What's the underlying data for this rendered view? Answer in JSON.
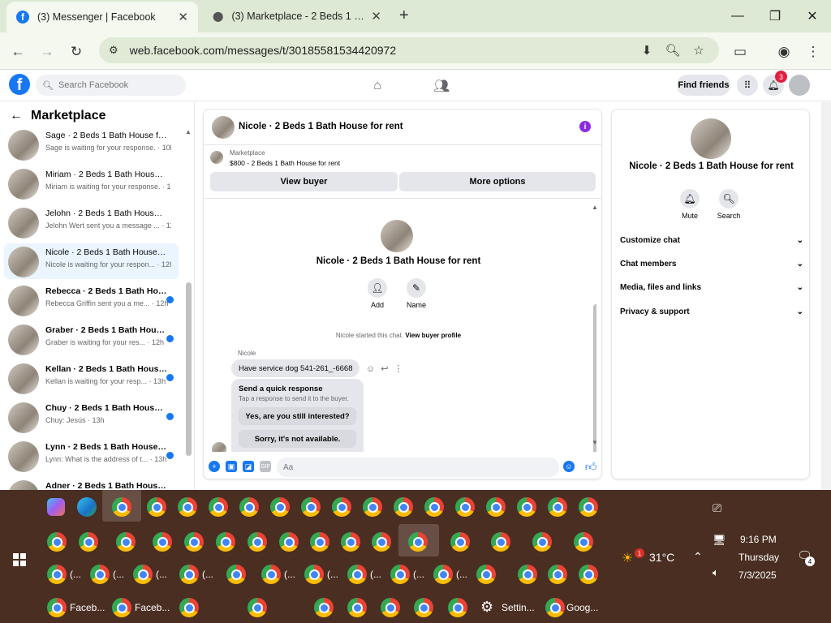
{
  "browser": {
    "tabs": [
      {
        "title": "(3) Messenger | Facebook"
      },
      {
        "title": "(3) Marketplace - 2 Beds 1 Bath"
      }
    ],
    "url": "web.facebook.com/messages/t/30185581534420972",
    "new_tab_glyph": "+",
    "close_glyph": "✕"
  },
  "facebook_header": {
    "logo_letter": "f",
    "search_placeholder": "Search Facebook",
    "find_friends": "Find friends",
    "notification_count": "3"
  },
  "marketplace": {
    "title": "Marketplace",
    "conversations": [
      {
        "name": "Sage · 2 Beds 1 Bath House for ...",
        "preview": "Sage is waiting for your response. · 10h",
        "unread": false,
        "selected": false
      },
      {
        "name": "Miriam · 2 Beds 1 Bath House f...",
        "preview": "Miriam is waiting for your response. · 10h",
        "unread": false,
        "selected": false
      },
      {
        "name": "Jelohn · 2 Beds 1 Bath House fo...",
        "preview": "Jelohn Wert sent you a message ... · 11h",
        "unread": false,
        "selected": false
      },
      {
        "name": "Nicole · 2 Beds 1 Bath House fo...",
        "preview": "Nicole is waiting for your respon... · 12h",
        "unread": false,
        "selected": true
      },
      {
        "name": "Rebecca · 2 Beds 1 Bath Hous...",
        "preview": "Rebecca Griffin sent you a me... · 12h",
        "unread": true,
        "selected": false
      },
      {
        "name": "Graber · 2 Beds 1 Bath House ...",
        "preview": "Graber is waiting for your res... · 12h",
        "unread": true,
        "selected": false
      },
      {
        "name": "Kellan · 2 Beds 1 Bath House f...",
        "preview": "Kellan is waiting for your resp... · 13h",
        "unread": true,
        "selected": false
      },
      {
        "name": "Chuy · 2 Beds 1 Bath House f...",
        "preview": "Chuy: Jesús · 13h",
        "unread": true,
        "selected": false
      },
      {
        "name": "Lynn · 2 Beds 1 Bath House fo...",
        "preview": "Lynn: What is the address of t... · 13h",
        "unread": true,
        "selected": false
      },
      {
        "name": "Adner · 2 Beds 1 Bath House f...",
        "preview": "",
        "unread": true,
        "selected": false
      }
    ]
  },
  "chat": {
    "title": "Nicole · 2 Beds 1 Bath House for rent",
    "marketplace_label": "Marketplace",
    "listing": "$800 - 2 Beds 1 Bath House for rent",
    "view_buyer": "View buyer",
    "more_options": "More options",
    "profile_name": "Nicole · 2 Beds 1 Bath House for rent",
    "add_label": "Add",
    "name_label": "Name",
    "start_note": "Nicole started this chat.",
    "view_buyer_profile": "View buyer profile",
    "sender": "Nicole",
    "message": "Have service dog 541-261_-6668",
    "quick_title": "Send a quick response",
    "quick_sub": "Tap a response to send it to the buyer.",
    "quick_responses": [
      "Yes, are you still interested?",
      "Sorry, it's not available."
    ],
    "input_placeholder": "Aa",
    "gif_label": "GIF"
  },
  "details": {
    "name": "Nicole · 2 Beds 1 Bath House for rent",
    "mute": "Mute",
    "search": "Search",
    "sections": [
      "Customize chat",
      "Chat members",
      "Media, files and links",
      "Privacy & support"
    ]
  },
  "taskbar": {
    "weather_temp": "31°C",
    "weather_badge": "1",
    "time": "9:16 PM",
    "day": "Thursday",
    "date": "7/3/2025",
    "notifications_count": "4",
    "row3_labels": [
      "(...",
      "(...",
      "(...",
      "(...",
      "(...",
      "(...",
      "(...",
      "(...",
      "(...",
      "(..."
    ],
    "row4_labels": [
      "Faceb...",
      "Faceb...",
      "Settin...",
      "Goog..."
    ]
  },
  "colors": {
    "fb_blue": "#1877f2",
    "browser_frame": "#dde9d4",
    "taskbar": "#4a2e22",
    "selected_conv": "#ebf5ff",
    "info_purple": "#8a2be2",
    "notification_red": "#e41e3f"
  }
}
